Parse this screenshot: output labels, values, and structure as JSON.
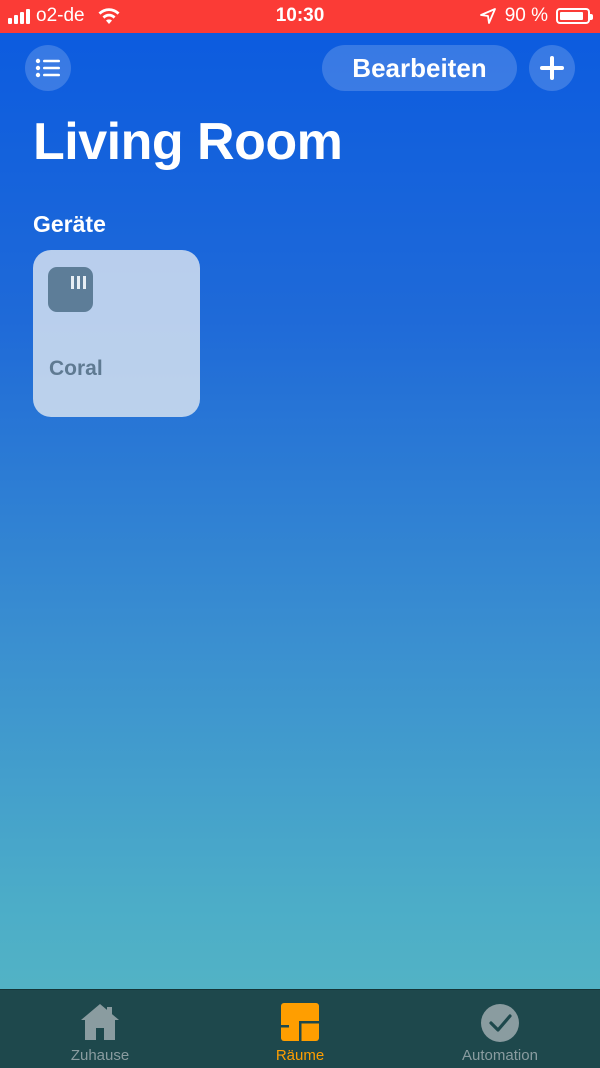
{
  "status_bar": {
    "carrier": "o2-de",
    "time": "10:30",
    "battery_percent": "90 %",
    "battery_level": 0.9,
    "icons": [
      "signal-icon",
      "wifi-icon",
      "location-icon",
      "battery-icon"
    ]
  },
  "header": {
    "edit_label": "Bearbeiten",
    "menu_icon": "list-icon",
    "add_icon": "plus-icon"
  },
  "page": {
    "title": "Living Room",
    "section_label": "Geräte"
  },
  "devices": [
    {
      "name": "Coral",
      "icon": "device-icon"
    }
  ],
  "tabs": [
    {
      "label": "Zuhause",
      "icon": "home-icon",
      "active": false
    },
    {
      "label": "Räume",
      "icon": "rooms-icon",
      "active": true
    },
    {
      "label": "Automation",
      "icon": "checkmark-clock-icon",
      "active": false
    }
  ],
  "colors": {
    "status_bar": "#fb3b36",
    "background_top": "#0a5ae0",
    "background_bottom": "#58b8c2",
    "tab_bar": "#1e484c",
    "active_tab": "#ff9e00",
    "inactive_tab": "#8a9ca0"
  }
}
